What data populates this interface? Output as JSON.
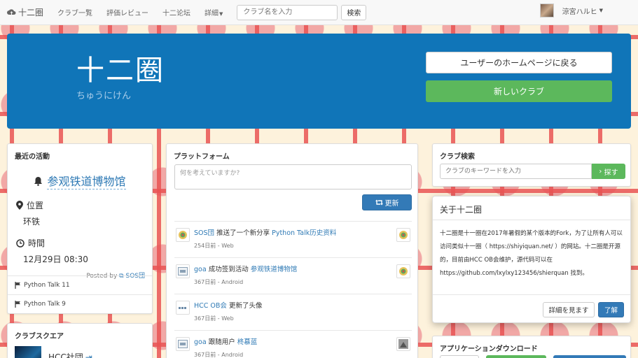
{
  "nav": {
    "brand": "十二圈",
    "links": [
      "クラブ一覧",
      "評価レビュー",
      "十二论坛",
      "詳細"
    ],
    "search_placeholder": "クラブ名を入力",
    "search_button": "検索",
    "user_name": "涼宮ハルヒ"
  },
  "hero": {
    "title": "十二圈",
    "subtitle": "ちゅうにけん",
    "back_button": "ユーザーのホームページに戻る",
    "new_club_button": "新しいクラブ"
  },
  "recent": {
    "heading": "最近の活動",
    "activity_title": "参观铁道博物馆",
    "location_label": "位置",
    "location_value": "环铁",
    "time_label": "時間",
    "time_value": "12月29日 08:30",
    "posted_by_prefix": "Posted by",
    "posted_by": "SOS団",
    "flags": [
      "Python Talk 11",
      "Python Talk 9"
    ]
  },
  "square": {
    "heading": "クラブスクエア",
    "club_name": "HCC社団"
  },
  "platform": {
    "heading": "プラットフォーム",
    "post_placeholder": "何を考えていますか?",
    "update_button": "更新",
    "feed": [
      {
        "user": "SOS団",
        "action": " 推送了一个新分享 ",
        "target": "Python Talk历史资料",
        "meta": "254日前 - Web"
      },
      {
        "user": "goa",
        "action": " 成功签到活动 ",
        "target": "参观铁道博物馆",
        "meta": "367日前 - Android"
      },
      {
        "user": "HCC OB会",
        "action": " 更新了头像",
        "target": "",
        "meta": "367日前 - Web"
      },
      {
        "user": "goa",
        "action": " 跟随用户 ",
        "target": "柊慕蓝",
        "meta": "367日前 - Android"
      }
    ]
  },
  "club_search": {
    "heading": "クラブ検索",
    "placeholder": "クラブのキーワードを入力",
    "button": "探す"
  },
  "about": {
    "title": "关于十二圈",
    "body": "十二圈是十一圈在2017年暑假的某个版本的Fork，为了让所有人可以访问类似十一圈（ https://shiyiquan.net/ ）的网站。十二圈是开源的，目前由HCC OB会维护，源代码可以在 https://github.com/lxylxy123456/shierquan 找到。",
    "detail_button": "詳細を見ます",
    "ok_button": "了解"
  },
  "download": {
    "heading": "アプリケーションダウンロード"
  },
  "colors": {
    "hero_blue": "#1075b8",
    "primary": "#337ab7",
    "success": "#5cb85c",
    "link": "#2f7ab5"
  }
}
